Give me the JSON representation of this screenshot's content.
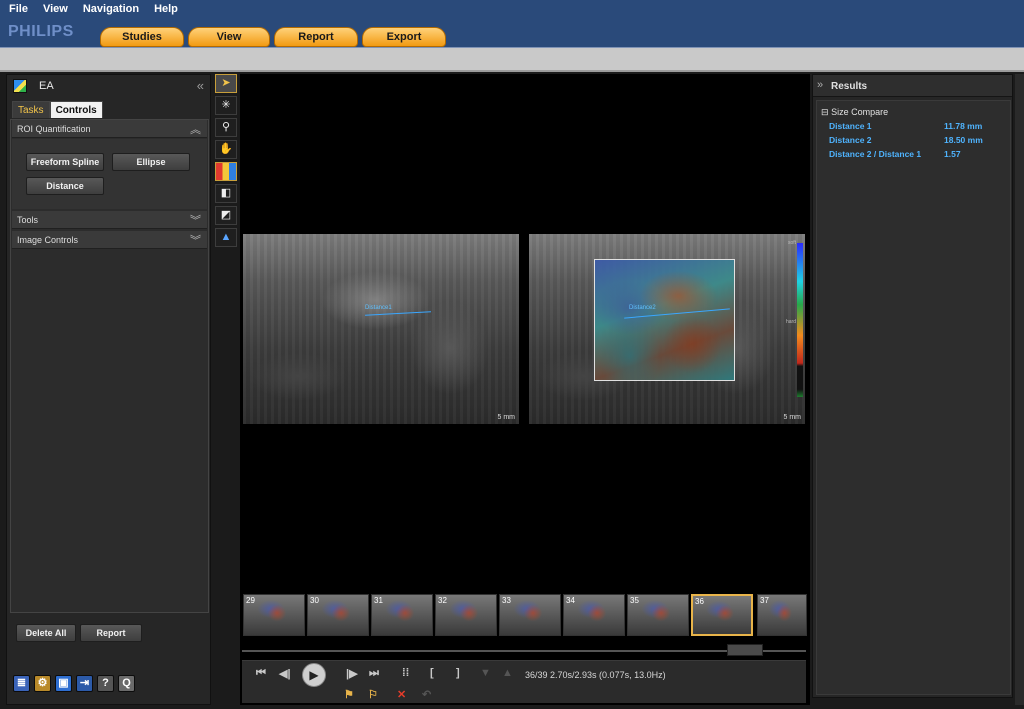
{
  "menu": [
    "File",
    "View",
    "Navigation",
    "Help"
  ],
  "brand": "PHILIPS",
  "main_tabs": [
    "Studies",
    "View",
    "Report",
    "Export"
  ],
  "left_panel": {
    "title": "EA",
    "tabs": [
      "Tasks",
      "Controls"
    ],
    "sections": {
      "roi": "ROI Quantification",
      "tools": "Tools",
      "image_controls": "Image Controls"
    },
    "roi_buttons": {
      "freeform": "Freeform Spline",
      "ellipse": "Ellipse",
      "distance": "Distance"
    },
    "bottom": {
      "delete_all": "Delete All",
      "report": "Report"
    }
  },
  "viewer": {
    "scale_left": "5 mm",
    "scale_right": "5 mm",
    "distance_label_left": "Distance1",
    "distance_label_right": "Distance2",
    "colorbar_top": "soft",
    "colorbar_mid": "hard",
    "frame_status": "36/39  2.70s/2.93s (0.077s, 13.0Hz)"
  },
  "thumbnails": [
    {
      "num": "29",
      "selected": false
    },
    {
      "num": "30",
      "selected": false
    },
    {
      "num": "31",
      "selected": false
    },
    {
      "num": "32",
      "selected": false
    },
    {
      "num": "33",
      "selected": false
    },
    {
      "num": "34",
      "selected": false
    },
    {
      "num": "35",
      "selected": false
    },
    {
      "num": "36",
      "selected": true
    },
    {
      "num": "37",
      "selected": false
    }
  ],
  "results": {
    "title": "Results",
    "group": "Size Compare",
    "rows": [
      {
        "label": "Distance 1",
        "value": "11.78 mm"
      },
      {
        "label": "Distance 2",
        "value": "18.50 mm"
      },
      {
        "label": "Distance 2 / Distance 1",
        "value": "1.57"
      }
    ]
  },
  "colors": {
    "header_bg": "#2a4a7a",
    "tab_orange": "#f29a12",
    "result_blue": "#4fb4ff",
    "selected_thumb": "#e8b44a"
  }
}
